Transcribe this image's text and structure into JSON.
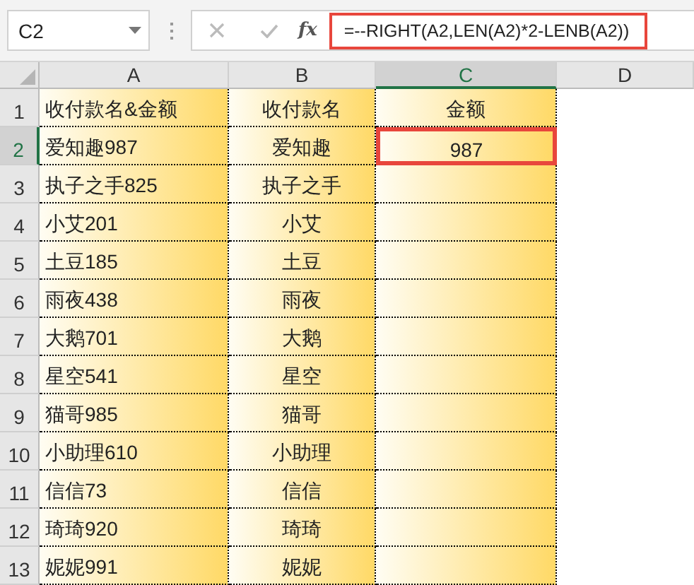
{
  "name_box": {
    "value": "C2"
  },
  "formula_bar": {
    "function_label": "fx",
    "formula": "=--RIGHT(A2,LEN(A2)*2-LENB(A2))"
  },
  "columns": [
    {
      "label": "A",
      "selected": false
    },
    {
      "label": "B",
      "selected": false
    },
    {
      "label": "C",
      "selected": true
    },
    {
      "label": "D",
      "selected": false
    }
  ],
  "rows": [
    {
      "number": "1",
      "selected": false,
      "cells": [
        {
          "text": "收付款名&金额",
          "selected": false
        },
        {
          "text": "收付款名",
          "selected": false
        },
        {
          "text": "金额",
          "selected": false
        }
      ]
    },
    {
      "number": "2",
      "selected": true,
      "cells": [
        {
          "text": "爱知趣987",
          "selected": false
        },
        {
          "text": "爱知趣",
          "selected": false
        },
        {
          "text": "987",
          "selected": true
        }
      ]
    },
    {
      "number": "3",
      "selected": false,
      "cells": [
        {
          "text": "执子之手825",
          "selected": false
        },
        {
          "text": "执子之手",
          "selected": false
        },
        {
          "selected": false
        }
      ]
    },
    {
      "number": "4",
      "selected": false,
      "cells": [
        {
          "text": "小艾201",
          "selected": false
        },
        {
          "text": "小艾",
          "selected": false
        },
        {
          "selected": false
        }
      ]
    },
    {
      "number": "5",
      "selected": false,
      "cells": [
        {
          "text": "土豆185",
          "selected": false
        },
        {
          "text": "土豆",
          "selected": false
        },
        {
          "selected": false
        }
      ]
    },
    {
      "number": "6",
      "selected": false,
      "cells": [
        {
          "text": "雨夜438",
          "selected": false
        },
        {
          "text": "雨夜",
          "selected": false
        },
        {
          "selected": false
        }
      ]
    },
    {
      "number": "7",
      "selected": false,
      "cells": [
        {
          "text": "大鹅701",
          "selected": false
        },
        {
          "text": "大鹅",
          "selected": false
        },
        {
          "selected": false
        }
      ]
    },
    {
      "number": "8",
      "selected": false,
      "cells": [
        {
          "text": "星空541",
          "selected": false
        },
        {
          "text": "星空",
          "selected": false
        },
        {
          "selected": false
        }
      ]
    },
    {
      "number": "9",
      "selected": false,
      "cells": [
        {
          "text": "猫哥985",
          "selected": false
        },
        {
          "text": "猫哥",
          "selected": false
        },
        {
          "selected": false
        }
      ]
    },
    {
      "number": "10",
      "selected": false,
      "cells": [
        {
          "text": "小助理610",
          "selected": false
        },
        {
          "text": "小助理",
          "selected": false
        },
        {
          "selected": false
        }
      ]
    },
    {
      "number": "11",
      "selected": false,
      "cells": [
        {
          "text": "信信73",
          "selected": false
        },
        {
          "text": "信信",
          "selected": false
        },
        {
          "selected": false
        }
      ]
    },
    {
      "number": "12",
      "selected": false,
      "cells": [
        {
          "text": "琦琦920",
          "selected": false
        },
        {
          "text": "琦琦",
          "selected": false
        },
        {
          "selected": false
        }
      ]
    },
    {
      "number": "13",
      "selected": false,
      "cells": [
        {
          "text": "妮妮991",
          "selected": false
        },
        {
          "text": "妮妮",
          "selected": false
        },
        {
          "selected": false
        }
      ]
    }
  ]
}
